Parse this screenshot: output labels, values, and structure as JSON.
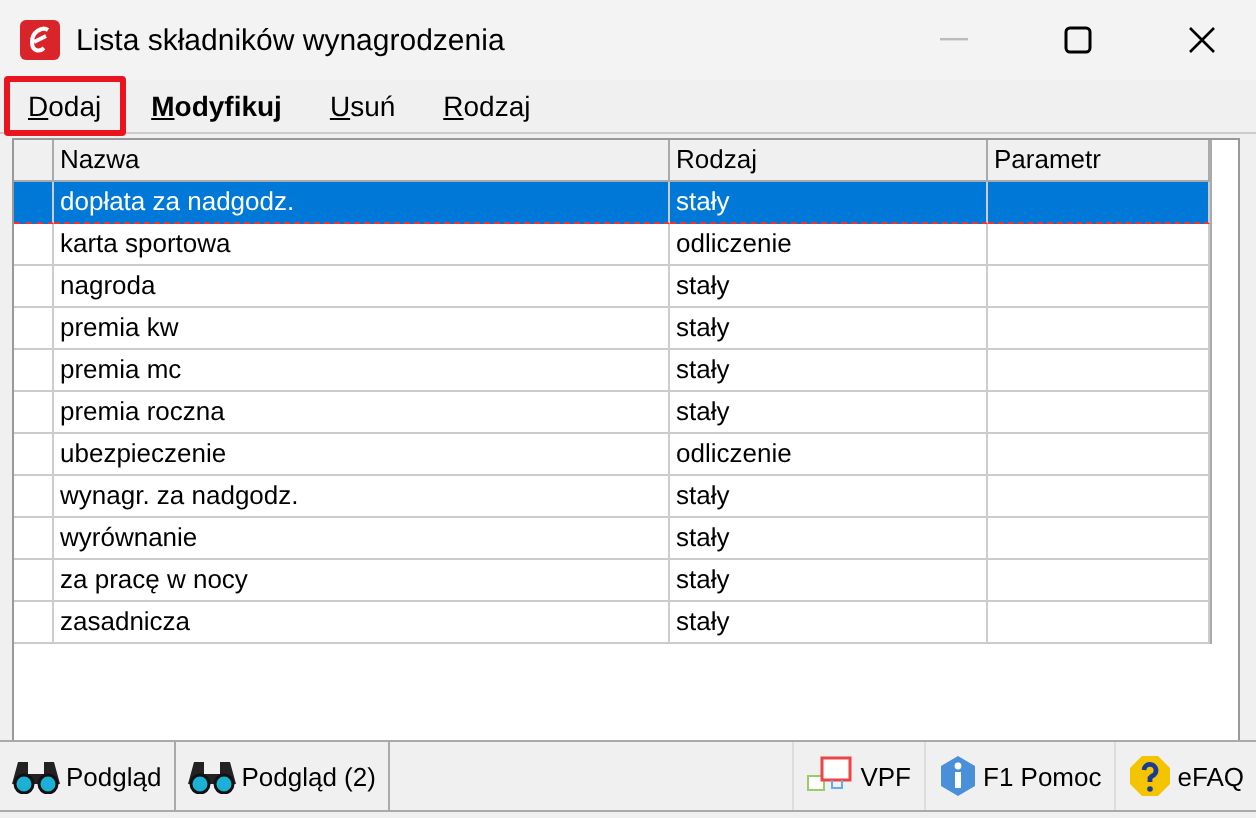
{
  "window": {
    "title": "Lista składników wynagrodzenia"
  },
  "menu": [
    {
      "label": "Dodaj",
      "bold": false,
      "highlighted": true
    },
    {
      "label": "Modyfikuj",
      "bold": true,
      "highlighted": false
    },
    {
      "label": "Usuń",
      "bold": false,
      "highlighted": false
    },
    {
      "label": "Rodzaj",
      "bold": false,
      "highlighted": false
    }
  ],
  "table": {
    "columns": [
      "Nazwa",
      "Rodzaj",
      "Parametr"
    ],
    "rows": [
      {
        "cells": [
          "dopłata za nadgodz.",
          "stały",
          ""
        ],
        "selected": true
      },
      {
        "cells": [
          "karta sportowa",
          "odliczenie",
          ""
        ],
        "selected": false
      },
      {
        "cells": [
          "nagroda",
          "stały",
          ""
        ],
        "selected": false
      },
      {
        "cells": [
          "premia kw",
          "stały",
          ""
        ],
        "selected": false
      },
      {
        "cells": [
          "premia mc",
          "stały",
          ""
        ],
        "selected": false
      },
      {
        "cells": [
          "premia roczna",
          "stały",
          ""
        ],
        "selected": false
      },
      {
        "cells": [
          "ubezpieczenie",
          "odliczenie",
          ""
        ],
        "selected": false
      },
      {
        "cells": [
          "wynagr. za nadgodz.",
          "stały",
          ""
        ],
        "selected": false
      },
      {
        "cells": [
          "wyrównanie",
          "stały",
          ""
        ],
        "selected": false
      },
      {
        "cells": [
          "za pracę w nocy",
          "stały",
          ""
        ],
        "selected": false
      },
      {
        "cells": [
          "zasadnicza",
          "stały",
          ""
        ],
        "selected": false
      }
    ]
  },
  "status_bar": {
    "left": [
      {
        "label": "Podgląd",
        "kind": "binoculars"
      },
      {
        "label": "Podgląd (2)",
        "kind": "binoculars"
      }
    ],
    "right": [
      {
        "label": "VPF",
        "kind": "vpf"
      },
      {
        "label": "F1 Pomoc",
        "kind": "info"
      },
      {
        "label": "eFAQ",
        "kind": "help"
      }
    ]
  }
}
